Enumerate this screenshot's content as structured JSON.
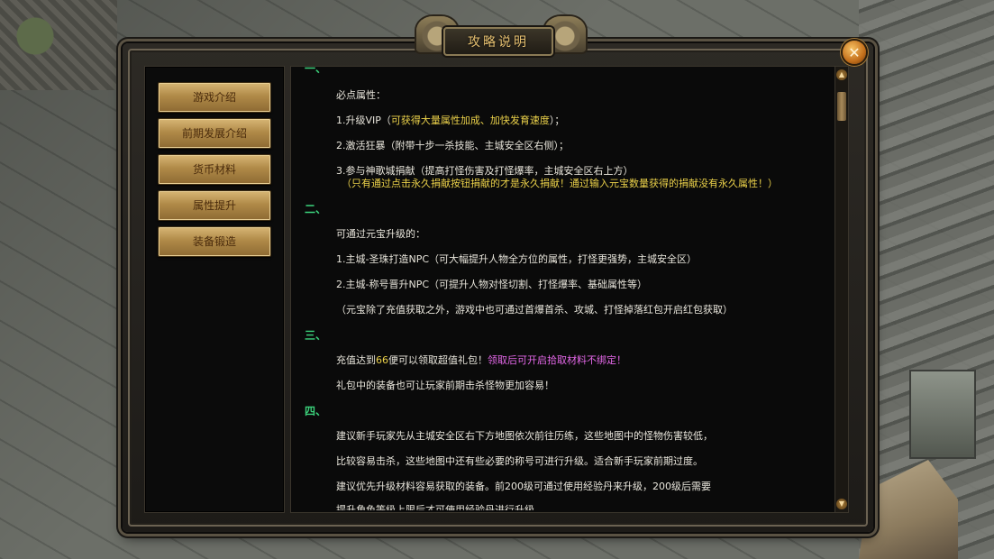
{
  "dialog": {
    "title": "攻略说明",
    "close_icon": "close-icon"
  },
  "menu": [
    {
      "label": "游戏介绍"
    },
    {
      "label": "前期发展介绍"
    },
    {
      "label": "货币材料"
    },
    {
      "label": "属性提升"
    },
    {
      "label": "装备锻造"
    }
  ],
  "content": {
    "s1_header": "一、",
    "s1_intro": "必点属性：",
    "s1_item1_a": "1.升级VIP（",
    "s1_item1_b": "可获得大量属性加成、加快发育速度",
    "s1_item1_c": "）；",
    "s1_item2": "2.激活狂暴（附带十步一杀技能、主城安全区右侧）；",
    "s1_item3": "3.参与神歌城捐献（提高打怪伤害及打怪爆率，主城安全区右上方）",
    "s1_note": "（只有通过点击永久捐献按钮捐献的才是永久捐献！通过输入元宝数量获得的捐献没有永久属性！）",
    "s2_header": "二、",
    "s2_intro": "可通过元宝升级的：",
    "s2_item1": "1.主城-圣珠打造NPC（可大幅提升人物全方位的属性，打怪更强势，主城安全区）",
    "s2_item2": "2.主城-称号晋升NPC（可提升人物对怪切割、打怪爆率、基础属性等）",
    "s2_note": "（元宝除了充值获取之外，游戏中也可通过首爆首杀、攻城、打怪掉落红包开启红包获取）",
    "s3_header": "三、",
    "s3_line1_a": "充值达到",
    "s3_line1_b": "66",
    "s3_line1_c": "便可以领取超值礼包！",
    "s3_line1_d": "领取后可开启拾取材料不绑定！",
    "s3_line2": "礼包中的装备也可让玩家前期击杀怪物更加容易！",
    "s4_header": "四、",
    "s4_line1": "建议新手玩家先从主城安全区右下方地图依次前往历练，这些地图中的怪物伤害较低，",
    "s4_line2": "比较容易击杀，这些地图中还有些必要的称号可进行升级。适合新手玩家前期过度。",
    "s4_line3": "建议优先升级材料容易获取的装备。前200级可通过使用经验丹来升级，200级后需要",
    "s4_line4": "提升角色等级上限后才可使用经验丹进行升级"
  },
  "scrollbar": {
    "up_icon": "chevron-up-icon",
    "down_icon": "chevron-down-icon"
  },
  "colors": {
    "section_header": "#3bd07a",
    "highlight_yellow": "#ecd24a",
    "highlight_magenta": "#e468e8",
    "menu_button": "#c09a55"
  }
}
